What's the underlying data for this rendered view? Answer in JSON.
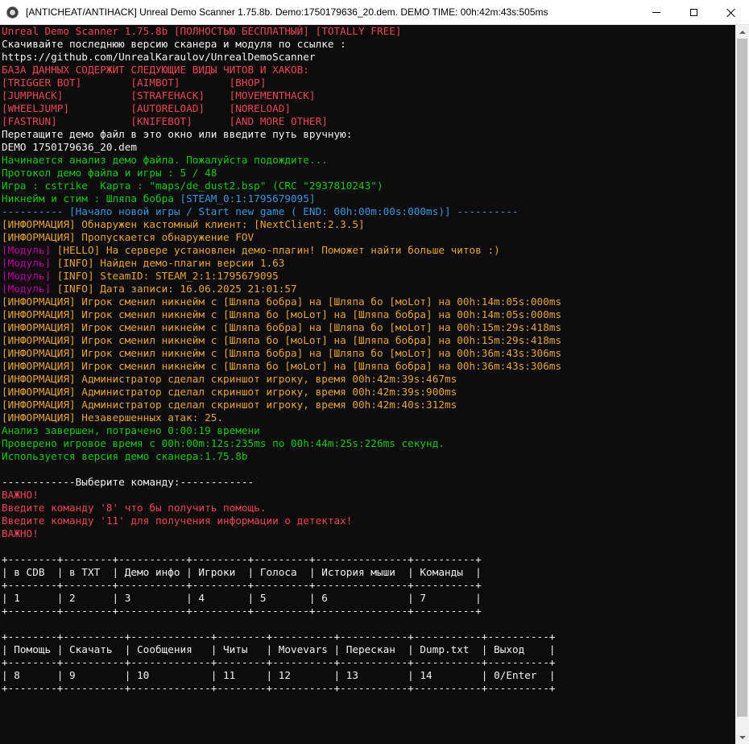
{
  "window": {
    "title": "[ANTICHEAT/ANTIHACK] Unreal Demo Scanner 1.75.8b. Demo:1750179636_20.dem. DEMO TIME: 00h:42m:43s:505ms",
    "icon": "app-icon",
    "controls": [
      "minimize-icon",
      "maximize-icon",
      "close-icon"
    ]
  },
  "colors": {
    "background": "#0c0c0c",
    "red": "#e74856",
    "white": "#f2f2f2",
    "green": "#16c60c",
    "cyan": "#3a96dd",
    "orange": "#e8a33a",
    "magenta": "#b4009e"
  },
  "lines": [
    [
      {
        "t": "Unreal Demo Scanner 1.75.8b [ПОЛНОСТЬЮ БЕСПЛАТНЫЙ] [TOTALLY FREE]",
        "c": "red"
      }
    ],
    [
      {
        "t": "Скачивайте последнюю версию сканера и модуля по ссылке :",
        "c": "white"
      }
    ],
    [
      {
        "t": "https://github.com/UnrealKaraulov/UnrealDemoScanner",
        "c": "white"
      }
    ],
    [
      {
        "t": "БАЗА ДАННЫХ СОДЕРЖИТ СЛЕДУЮЩИЕ ВИДЫ ЧИТОВ И ХАКОВ:",
        "c": "red"
      }
    ],
    [
      {
        "t": "[TRIGGER BOT]        [AIMBOT]        [BHOP]",
        "c": "red"
      }
    ],
    [
      {
        "t": "[JUMPHACK]           [STRAFEHACK]    [MOVEMENTHACK]",
        "c": "red"
      }
    ],
    [
      {
        "t": "[WHEELJUMP]          [AUTORELOAD]    [NORELOAD]",
        "c": "red"
      }
    ],
    [
      {
        "t": "[FASTRUN]            [KNIFEBOT]      [AND MORE OTHER]",
        "c": "red"
      }
    ],
    [
      {
        "t": "Перетащите демо файл в это окно или введите путь вручную:",
        "c": "white"
      }
    ],
    [
      {
        "t": "DEMO 1750179636_20.dem",
        "c": "white"
      }
    ],
    [
      {
        "t": "Начинается анализ демо файла. Пожалуйста подождите...",
        "c": "green"
      }
    ],
    [
      {
        "t": "Протокол демо файла и игры : 5 / 48",
        "c": "green"
      }
    ],
    [
      {
        "t": "Игра : cstrike  Карта : \"maps/de_dust2.bsp\" (CRC \"2937810243\")",
        "c": "green"
      }
    ],
    [
      {
        "t": "Никнейм и стим : Шляпа бобра ",
        "c": "green"
      },
      {
        "t": "[STEAM_0:1:1795679095]",
        "c": "cyan"
      }
    ],
    [
      {
        "t": "---------- [Начало новой игры / Start new game ( END: 00h:00m:00s:000ms)] ----------",
        "c": "cyan"
      }
    ],
    [
      {
        "t": "[ИНФОРМАЦИЯ] Обнаружен кастомный клиент: [NextClient:2.3.5]",
        "c": "orange"
      }
    ],
    [
      {
        "t": "[ИНФОРМАЦИЯ] Пропускается обнаружение FOV",
        "c": "orange"
      }
    ],
    [
      {
        "t": "[Модуль]",
        "c": "magenta"
      },
      {
        "t": " [HELLO] На сервере установлен демо-плагин! Поможет найти больше читов :)",
        "c": "orange"
      }
    ],
    [
      {
        "t": "[Модуль]",
        "c": "magenta"
      },
      {
        "t": " [INFO] Найден демо-плагин версии 1.63",
        "c": "orange"
      }
    ],
    [
      {
        "t": "[Модуль]",
        "c": "magenta"
      },
      {
        "t": " [INFO] SteamID: STEAM_2:1:1795679095",
        "c": "orange"
      }
    ],
    [
      {
        "t": "[Модуль]",
        "c": "magenta"
      },
      {
        "t": " [INFO] Дата записи: 16.06.2025 21:01:57",
        "c": "orange"
      }
    ],
    [
      {
        "t": "[ИНФОРМАЦИЯ] Игрок сменил никнейм с [Шляпа бобра] на [Шляпа бо [мoLoт] на 00h:14m:05s:000ms",
        "c": "orange"
      }
    ],
    [
      {
        "t": "[ИНФОРМАЦИЯ] Игрок сменил никнейм с [Шляпа бо [мoLoт] на [Шляпа бобра] на 00h:14m:05s:000ms",
        "c": "orange"
      }
    ],
    [
      {
        "t": "[ИНФОРМАЦИЯ] Игрок сменил никнейм с [Шляпа бобра] на [Шляпа бо [мoLoт] на 00h:15m:29s:418ms",
        "c": "orange"
      }
    ],
    [
      {
        "t": "[ИНФОРМАЦИЯ] Игрок сменил никнейм с [Шляпа бо [мoLoт] на [Шляпа бобра] на 00h:15m:29s:418ms",
        "c": "orange"
      }
    ],
    [
      {
        "t": "[ИНФОРМАЦИЯ] Игрок сменил никнейм с [Шляпа бобра] на [Шляпа бо [мoLoт] на 00h:36m:43s:306ms",
        "c": "orange"
      }
    ],
    [
      {
        "t": "[ИНФОРМАЦИЯ] Игрок сменил никнейм с [Шляпа бо [мoLoт] на [Шляпа бобра] на 00h:36m:43s:306ms",
        "c": "orange"
      }
    ],
    [
      {
        "t": "[ИНФОРМАЦИЯ] Администратор сделал скриншот игроку, время 00h:42m:39s:467ms",
        "c": "orange"
      }
    ],
    [
      {
        "t": "[ИНФОРМАЦИЯ] Администратор сделал скриншот игроку, время 00h:42m:39s:900ms",
        "c": "orange"
      }
    ],
    [
      {
        "t": "[ИНФОРМАЦИЯ] Администратор сделал скриншот игроку, время 00h:42m:40s:312ms",
        "c": "orange"
      }
    ],
    [
      {
        "t": "[ИНФОРМАЦИЯ] Незавершенных атак: 25.",
        "c": "orange"
      }
    ],
    [
      {
        "t": "Анализ завершен, потрачено 0:00:19 времени",
        "c": "green"
      }
    ],
    [
      {
        "t": "Проверено игровое время с 00h:00m:12s:235ms по 00h:44m:25s:226ms секунд.",
        "c": "green"
      }
    ],
    [
      {
        "t": "Используется версия демо сканера:1.75.8b",
        "c": "green"
      }
    ],
    [
      {
        "t": "",
        "c": "white"
      }
    ],
    [
      {
        "t": "------------Выберите команду:------------",
        "c": "white"
      }
    ],
    [
      {
        "t": "ВАЖНО!",
        "c": "red"
      }
    ],
    [
      {
        "t": "Введите команду '8' что бы получить помощь.",
        "c": "red"
      }
    ],
    [
      {
        "t": "Введите команду '11' для получения информации о детектах!",
        "c": "red"
      }
    ],
    [
      {
        "t": "ВАЖНО!",
        "c": "red"
      }
    ],
    [
      {
        "t": "",
        "c": "white"
      }
    ],
    [
      {
        "t": "+--------+--------+-----------+---------+---------+---------------+----------+",
        "c": "white"
      }
    ],
    [
      {
        "t": "| в CDB  | в TXT  | Демо инфо | Игроки  | Голоса  | История мыши  | Команды  |",
        "c": "white"
      }
    ],
    [
      {
        "t": "+--------+--------+-----------+---------+---------+---------------+----------+",
        "c": "white"
      }
    ],
    [
      {
        "t": "| 1      | 2      | 3         | 4       | 5       | 6             | 7        |",
        "c": "white"
      }
    ],
    [
      {
        "t": "+--------+--------+-----------+---------+---------+---------------+----------+",
        "c": "white"
      }
    ],
    [
      {
        "t": "",
        "c": "white"
      }
    ],
    [
      {
        "t": "+--------+----------+-------------+--------+----------+-----------+-----------+----------+",
        "c": "white"
      }
    ],
    [
      {
        "t": "| Помощь | Скачать  | Сообщения   | Читы   | Movevars | Перескан  | Dump.txt  | Выход    |",
        "c": "white"
      }
    ],
    [
      {
        "t": "+--------+----------+-------------+--------+----------+-----------+-----------+----------+",
        "c": "white"
      }
    ],
    [
      {
        "t": "| 8      | 9        | 10          | 11     | 12       | 13        | 14        | 0/Enter  |",
        "c": "white"
      }
    ],
    [
      {
        "t": "+--------+----------+-------------+--------+----------+-----------+-----------+----------+",
        "c": "white"
      }
    ]
  ]
}
